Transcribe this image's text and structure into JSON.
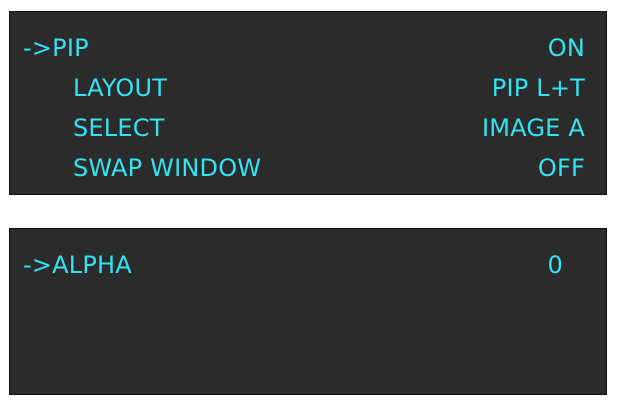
{
  "colors": {
    "panel_background": "#2b2b2b",
    "text": "#33e3f2",
    "page_background": "#ffffff"
  },
  "menu_pip": {
    "cursor": "->",
    "items": [
      {
        "label": "PIP",
        "value": "ON",
        "selected": true
      },
      {
        "label": "LAYOUT",
        "value": "PIP L+T",
        "selected": false
      },
      {
        "label": "SELECT",
        "value": "IMAGE A",
        "selected": false
      },
      {
        "label": "SWAP WINDOW",
        "value": "OFF",
        "selected": false
      }
    ]
  },
  "menu_alpha": {
    "cursor": "->",
    "items": [
      {
        "label": "ALPHA",
        "value": "0",
        "selected": true
      }
    ]
  }
}
